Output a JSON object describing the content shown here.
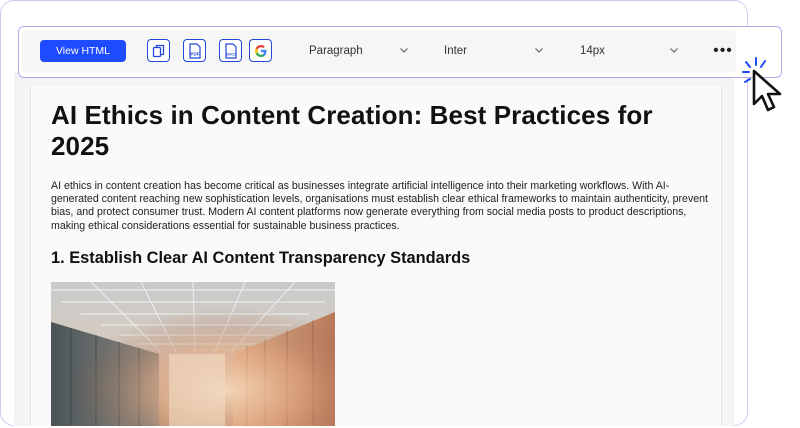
{
  "toolbar": {
    "view_html_label": "View HTML",
    "format_buttons": [
      {
        "name": "copy",
        "badge": ""
      },
      {
        "name": "pdf",
        "badge": "PDF"
      },
      {
        "name": "docx",
        "badge": "DOCX"
      },
      {
        "name": "google-docs",
        "badge": "G"
      }
    ],
    "block_style": "Paragraph",
    "font": "Inter",
    "font_size": "14px",
    "more_label": "•••"
  },
  "document": {
    "title": "AI Ethics in Content Creation: Best Practices for 2025",
    "intro": "AI ethics in content creation has become critical as businesses integrate artificial intelligence into their marketing workflows. With AI-generated content reaching new sophistication levels, organisations must establish clear ethical frameworks to maintain authenticity, prevent bias, and protect consumer trust. Modern AI content platforms now generate everything from social media posts to product descriptions, making ethical considerations essential for sustainable business practices.",
    "section_heading": "1. Establish Clear AI Content Transparency Standards"
  },
  "colors": {
    "accent": "#1e4bff",
    "toolbar_border": "#b7a9e6",
    "icon_outline": "#2347d9"
  }
}
